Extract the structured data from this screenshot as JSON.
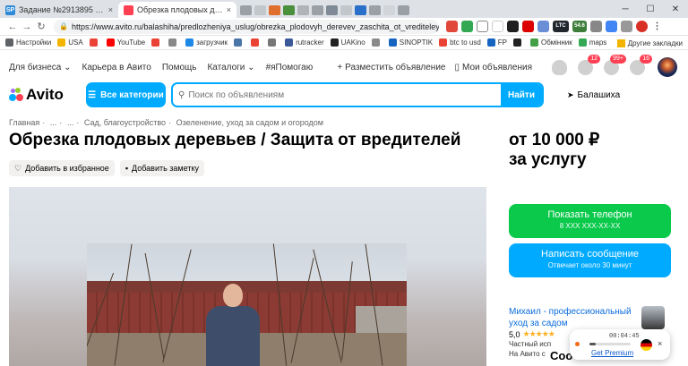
{
  "browser": {
    "tabs": [
      {
        "title": "Задание №2913895 - просмотр з",
        "favicon": "SP",
        "favicon_color": "#2d8ad8",
        "close": "×"
      },
      {
        "title": "Обрезка плодовых деревьев / За",
        "favicon": "avito-icon",
        "favicon_color": "#ff4053",
        "close": "×"
      }
    ],
    "url": "https://www.avito.ru/balashiha/predlozheniya_uslug/obrezka_plodovyh_derevev_zaschita_ot_vrediteley_7920403255?co...",
    "extension_badges": [
      "LTC",
      "54.6"
    ],
    "bookmarks": [
      "Настройки",
      "USA",
      "YouTube",
      "загрузчик",
      "rutracker",
      "UAKino",
      "SINOPTIK",
      "btc to usd",
      "FP",
      "Обмінник",
      "maps"
    ],
    "bookmarks_other": "Другие закладки"
  },
  "topnav": {
    "left": [
      "Для бизнеса ⌄",
      "Карьера в Авито",
      "Помощь",
      "Каталоги ⌄",
      "#яПомогаю"
    ],
    "post_ad": "Разместить объявление",
    "my_ads": "Мои объявления",
    "badges": [
      "12",
      "99+",
      "16"
    ]
  },
  "search": {
    "logo": "Avito",
    "categories_button": "Все категории",
    "placeholder": "Поиск по объявлениям",
    "search_button": "Найти",
    "location": "Балашиха"
  },
  "listing": {
    "breadcrumbs": [
      "Главная",
      "...",
      "...",
      "Сад, благоустройство",
      "Озеленение, уход за садом и огородом"
    ],
    "title": "Обрезка плодовых деревьев / Защита от вредителей",
    "favorite_button": "Добавить в избранное",
    "note_button": "Добавить заметку",
    "price_line1": "от 10 000 ₽",
    "price_line2": "за услугу",
    "show_phone": "Показать телефон",
    "phone_masked": "8 XXX XXX-XX-XX",
    "write_message": "Написать сообщение",
    "reply_time": "Отвечает около 30 минут",
    "seller_name": "Михаил - профессиональный уход за садом",
    "rating": "5,0",
    "stars": "★★★★★",
    "seller_type": "Частный исп",
    "seller_since": "На Авито с"
  },
  "widget": {
    "timer": "00:04:45",
    "progress": 0.15,
    "premium": "Get Premium",
    "close": "×",
    "flag": "germany-flag"
  },
  "overlay_text": "Coo"
}
